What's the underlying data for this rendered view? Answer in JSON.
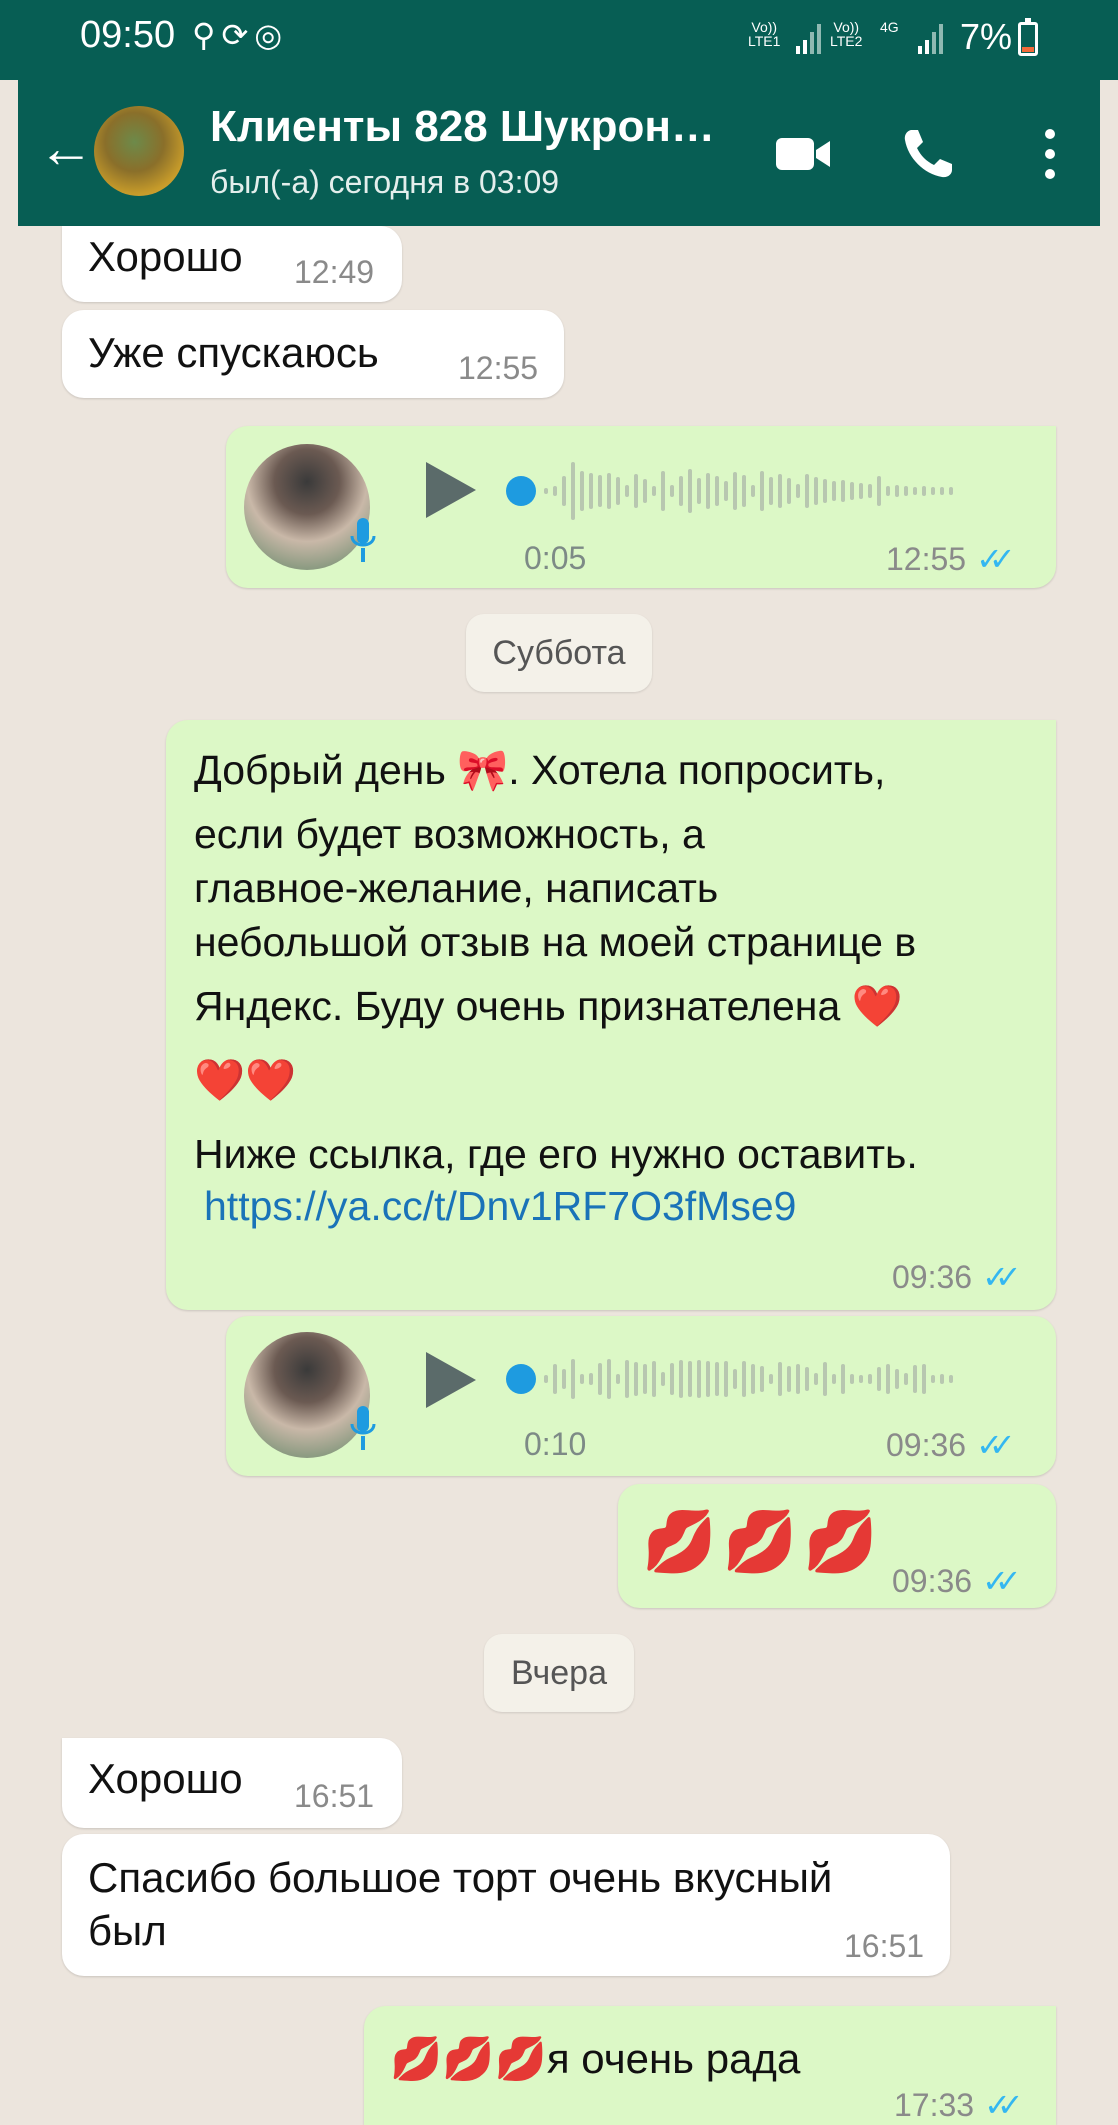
{
  "status_bar": {
    "time": "09:50",
    "sim1": "Vo))\nLTE1",
    "sim2": "Vo))\nLTE2",
    "network": "4G",
    "battery": "7%"
  },
  "header": {
    "title": "Клиенты 828 Шукрон…",
    "status": "был(-а) сегодня в 03:09",
    "icons": [
      "back-arrow-icon",
      "video-call-icon",
      "phone-icon",
      "more-vert-icon"
    ]
  },
  "messages": {
    "m1": {
      "text": "Хорошо",
      "time": "12:49"
    },
    "m2": {
      "text": "Уже спускаюсь",
      "time": "12:55"
    },
    "v1": {
      "duration": "0:05",
      "time": "12:55"
    },
    "date1": "Суббота",
    "m3": {
      "line1": "Добрый день 🎀.  Хотела попросить,",
      "line2": "если будет возможность,  а",
      "line3": "главное-желание,  написать",
      "line4": "небольшой отзыв на моей странице в",
      "line5": "Яндекс.  Буду очень признателена ❤️",
      "line6": "❤️❤️",
      "line7": "Ниже ссылка, где его нужно оставить.",
      "link": "https://ya.cc/t/Dnv1RF7O3fMse9",
      "time": "09:36"
    },
    "v2": {
      "duration": "0:10",
      "time": "09:36"
    },
    "m4": {
      "text": "💋💋💋",
      "time": "09:36"
    },
    "date2": "Вчера",
    "m5": {
      "text": "Хорошо",
      "time": "16:51"
    },
    "m6": {
      "line1": "Спасибо большое торт очень вкусный",
      "line2": "был",
      "time": "16:51"
    },
    "m7": {
      "text": "💋💋💋я очень рада",
      "time": "17:33"
    }
  },
  "read_ticks": "✓✓",
  "colors": {
    "header": "#075e54",
    "outgoing": "#dcf8c6",
    "incoming": "#ffffff",
    "tick": "#34b7f1",
    "link": "#1a73b8"
  }
}
